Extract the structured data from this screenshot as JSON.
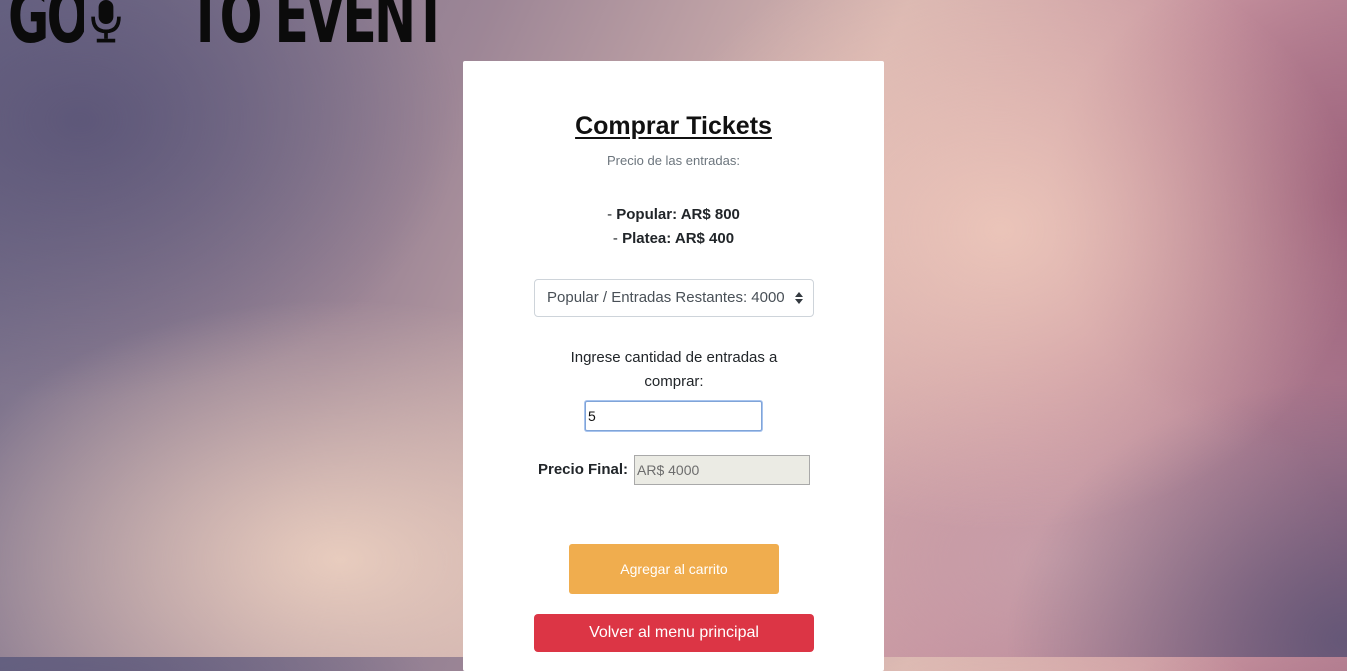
{
  "logo": {
    "part1": "GO",
    "part2": "TO EVENT"
  },
  "purchase": {
    "title": "Comprar Tickets",
    "subtitle": "Precio de las entradas:",
    "prices": [
      {
        "prefix": "- ",
        "label": "Popular: AR$ 800"
      },
      {
        "prefix": "- ",
        "label": "Platea: AR$ 400"
      }
    ],
    "ticket_select": {
      "selected": "Popular / Entradas Restantes: 4000"
    },
    "quantity": {
      "label": "Ingrese cantidad de entradas a comprar:",
      "value": "5"
    },
    "final_price": {
      "label": "Precio Final:",
      "value": "AR$ 4000"
    },
    "add_to_cart_label": "Agregar al carrito",
    "back_label": "Volver al menu principal"
  },
  "colors": {
    "add_to_cart": "#f0ad4e",
    "back": "#dc3545"
  },
  "icons": {
    "logo_microphone": "microphone-icon",
    "select_arrows": "sort-arrows-icon"
  }
}
